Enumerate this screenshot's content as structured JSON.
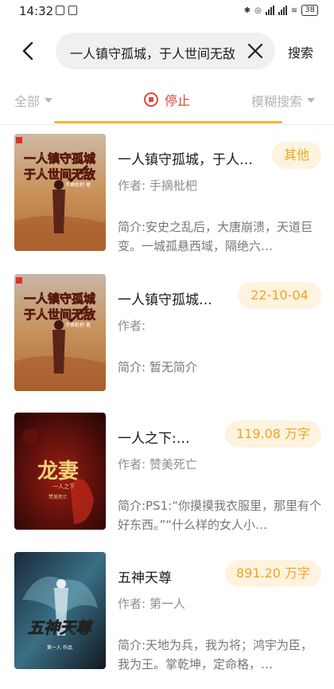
{
  "status": {
    "time": "14:32",
    "battery": "38"
  },
  "search": {
    "query": "一人镇守孤城，于人世间无敌",
    "button_label": "搜索"
  },
  "filters": {
    "all_label": "全部",
    "stop_label": "停止",
    "fuzzy_label": "模糊搜索"
  },
  "books": [
    {
      "title": "一人镇守孤城，于人…",
      "tag": "其他",
      "author": "作者: 手摘枇杷",
      "intro": "简介:安史之乱后，大唐崩溃，天道巨变。一城孤悬西域，隔绝六…",
      "cover_lines": [
        "一人镇守孤城",
        "于人世间无敌"
      ],
      "cover_small": "手摘枇杷 著"
    },
    {
      "title": "一人镇守孤城…",
      "tag": "22-10-04",
      "author": "作者:",
      "intro": "简介: 暂无简介",
      "cover_lines": [
        "一人镇守孤城",
        "于人世间无敌"
      ],
      "cover_small": "手摘枇杷 著"
    },
    {
      "title": "一人之下:…",
      "tag": "119.08 万字",
      "author": "作者: 赞美死亡",
      "intro": "简介:PS1:“你摸摸我衣服里，那里有个好东西。”“什么样的女人小…",
      "cover_lines": [
        "龙妻",
        "一人之下"
      ],
      "cover_small": "赞美死亡"
    },
    {
      "title": "五神天尊",
      "tag": "891.20 万字",
      "author": "作者: 第一人",
      "intro": "简介:天地为兵，我为将；鸿宇为臣，我为王。掌乾坤，定命格，…",
      "cover_lines": [
        "五神天尊"
      ],
      "cover_small": "第一人 作品"
    }
  ],
  "colors": {
    "accent": "#f2b533",
    "stop_red": "#e0473b",
    "tag_bg": "#fdf3df",
    "tag_text": "#f0a51e"
  }
}
